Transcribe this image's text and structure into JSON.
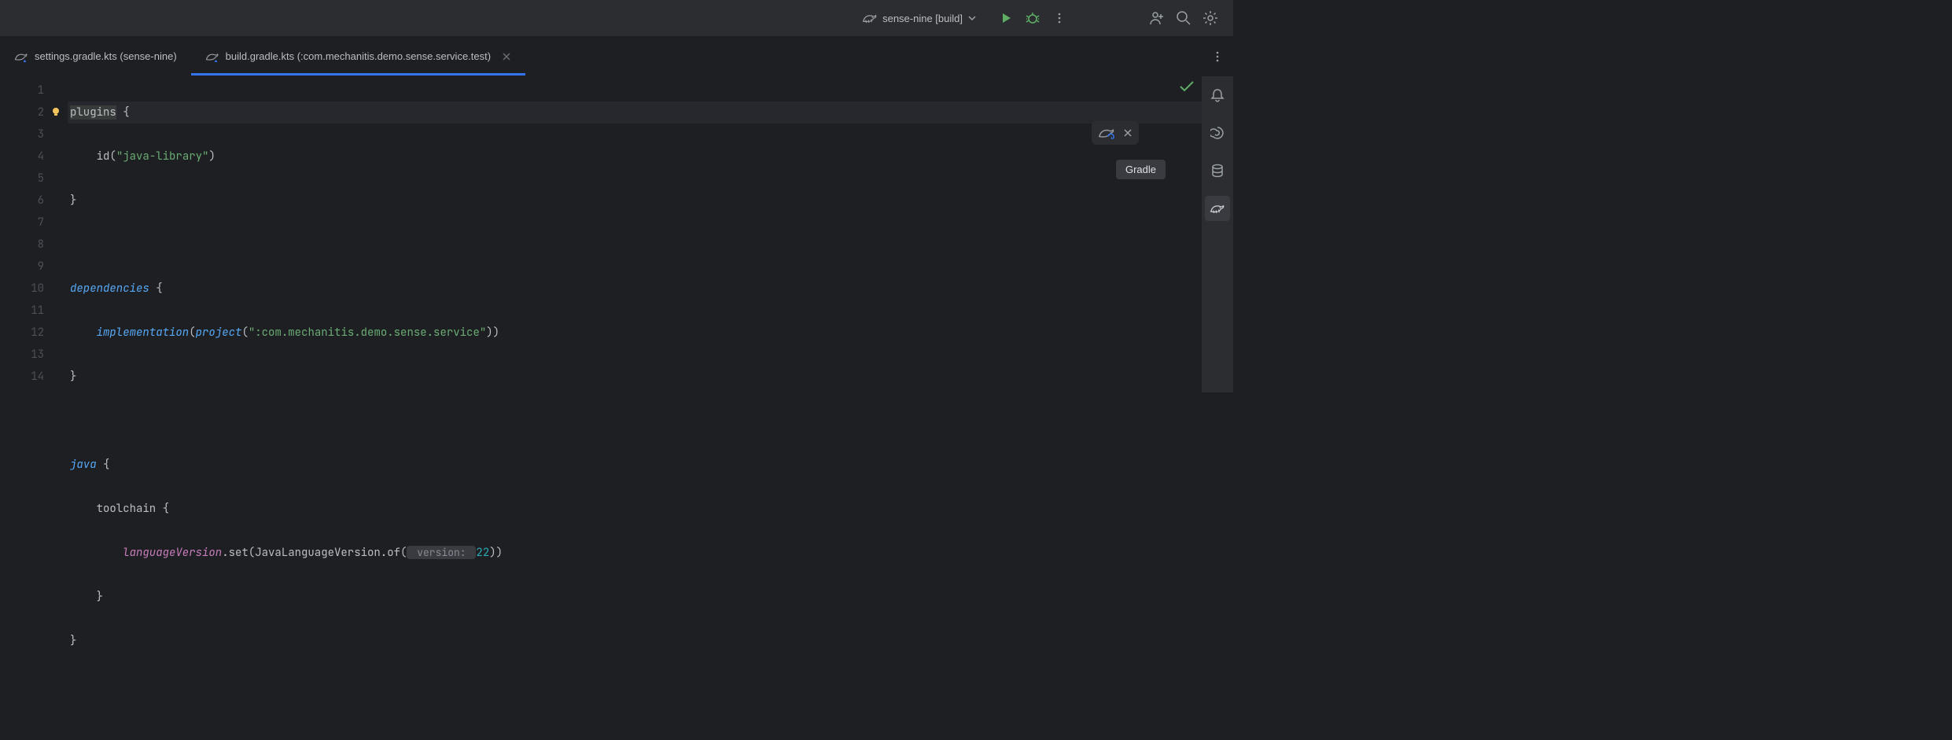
{
  "topbar": {
    "project_label": "sense-nine [build]"
  },
  "tabs": [
    {
      "label": "settings.gradle.kts (sense-nine)",
      "active": false,
      "closeable": false
    },
    {
      "label": "build.gradle.kts (:com.mechanitis.demo.sense.service.test)",
      "active": true,
      "closeable": true
    }
  ],
  "gutter": {
    "lines": [
      "1",
      "2",
      "3",
      "4",
      "5",
      "6",
      "7",
      "8",
      "9",
      "10",
      "11",
      "12",
      "13",
      "14"
    ],
    "bulb_on_line": 2
  },
  "code": {
    "l1_kw": "plugins",
    "l1_rest": " {",
    "l2_fn": "id",
    "l2_paren_open": "(",
    "l2_str": "\"java-library\"",
    "l2_paren_close": ")",
    "l3": "}",
    "l5_kw": "dependencies",
    "l5_rest": " {",
    "l6_fn1": "implementation",
    "l6_po": "(",
    "l6_fn2": "project",
    "l6_po2": "(",
    "l6_str": "\":com.mechanitis.demo.sense.service\"",
    "l6_pc": "))",
    "l7": "}",
    "l9_kw": "java",
    "l9_rest": " {",
    "l10_fn": "toolchain",
    "l10_rest": " {",
    "l11_prop": "languageVersion",
    "l11_dot": ".set(JavaLanguageVersion.of(",
    "l11_hint": " version: ",
    "l11_num": "22",
    "l11_close": "))",
    "l12": "    }",
    "l13": "}"
  },
  "tooltip": {
    "label": "Gradle"
  }
}
